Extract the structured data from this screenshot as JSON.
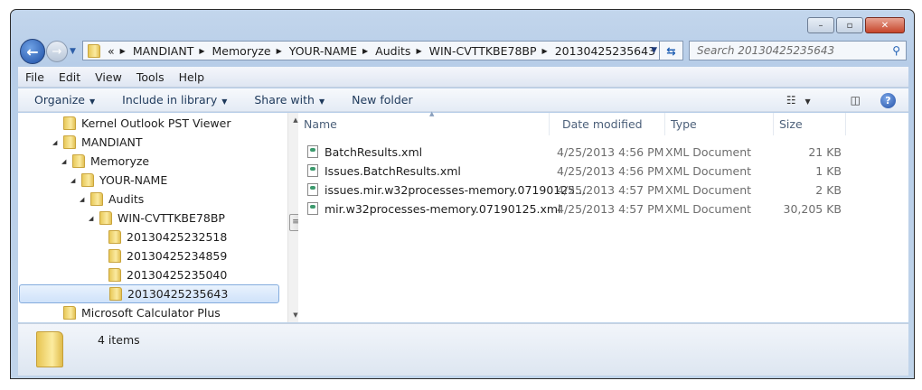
{
  "window": {
    "controls": {
      "minimize": "–",
      "maximize": "▫",
      "close": "✕"
    }
  },
  "address": {
    "overflow": "«",
    "crumbs": [
      "MANDIANT",
      "Memoryze",
      "YOUR-NAME",
      "Audits",
      "WIN-CVTTKBE78BP",
      "20130425235643"
    ]
  },
  "search": {
    "placeholder": "Search 20130425235643"
  },
  "menu": [
    "File",
    "Edit",
    "View",
    "Tools",
    "Help"
  ],
  "toolbar": {
    "organize": "Organize",
    "include": "Include in library",
    "share": "Share with",
    "new_folder": "New folder"
  },
  "tree": [
    {
      "label": "Kernel Outlook PST Viewer",
      "level": 0,
      "expanded": false
    },
    {
      "label": "MANDIANT",
      "level": 0,
      "expanded": true
    },
    {
      "label": "Memoryze",
      "level": 1,
      "expanded": true
    },
    {
      "label": "YOUR-NAME",
      "level": 2,
      "expanded": true
    },
    {
      "label": "Audits",
      "level": 3,
      "expanded": true
    },
    {
      "label": "WIN-CVTTKBE78BP",
      "level": 4,
      "expanded": true
    },
    {
      "label": "20130425232518",
      "level": 5,
      "expanded": false
    },
    {
      "label": "20130425234859",
      "level": 5,
      "expanded": false
    },
    {
      "label": "20130425235040",
      "level": 5,
      "expanded": false
    },
    {
      "label": "20130425235643",
      "level": 5,
      "expanded": false,
      "selected": true
    },
    {
      "label": "Microsoft Calculator Plus",
      "level": 0,
      "expanded": false
    }
  ],
  "columns": {
    "name": "Name",
    "date": "Date modified",
    "type": "Type",
    "size": "Size"
  },
  "files": [
    {
      "name": "BatchResults.xml",
      "date": "4/25/2013 4:56 PM",
      "type": "XML Document",
      "size": "21 KB"
    },
    {
      "name": "Issues.BatchResults.xml",
      "date": "4/25/2013 4:56 PM",
      "type": "XML Document",
      "size": "1 KB"
    },
    {
      "name": "issues.mir.w32processes-memory.07190125....",
      "date": "4/25/2013 4:57 PM",
      "type": "XML Document",
      "size": "2 KB"
    },
    {
      "name": "mir.w32processes-memory.07190125.xml",
      "date": "4/25/2013 4:57 PM",
      "type": "XML Document",
      "size": "30,205 KB"
    }
  ],
  "status": {
    "count": "4 items"
  }
}
